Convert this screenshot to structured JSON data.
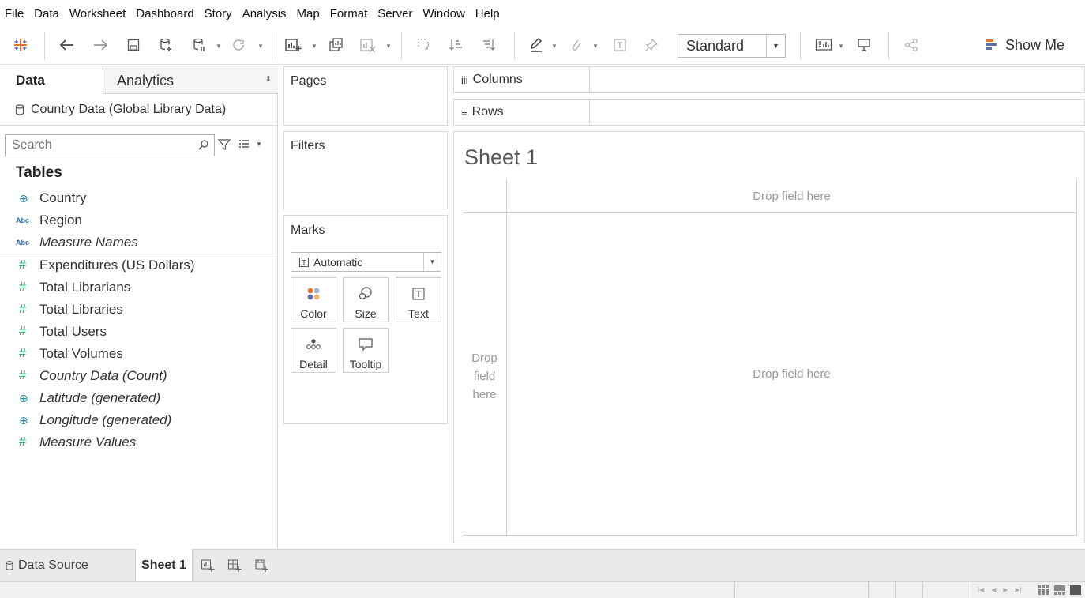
{
  "menu": [
    "File",
    "Data",
    "Worksheet",
    "Dashboard",
    "Story",
    "Analysis",
    "Map",
    "Format",
    "Server",
    "Window",
    "Help"
  ],
  "toolbar": {
    "fit_value": "Standard",
    "show_me_label": "Show Me"
  },
  "data_pane": {
    "tab_data": "Data",
    "tab_analytics": "Analytics",
    "datasource": "Country Data (Global Library Data)",
    "search_placeholder": "Search",
    "tables_title": "Tables",
    "dimensions": [
      {
        "label": "Country",
        "type": "geo",
        "italic": false
      },
      {
        "label": "Region",
        "type": "abc",
        "italic": false
      },
      {
        "label": "Measure Names",
        "type": "abc",
        "italic": true
      }
    ],
    "measures": [
      {
        "label": "Expenditures  (US Dollars)",
        "type": "number",
        "italic": false
      },
      {
        "label": "Total Librarians",
        "type": "number",
        "italic": false
      },
      {
        "label": "Total Libraries",
        "type": "number",
        "italic": false
      },
      {
        "label": "Total Users",
        "type": "number",
        "italic": false
      },
      {
        "label": "Total Volumes",
        "type": "number",
        "italic": false
      },
      {
        "label": "Country Data (Count)",
        "type": "number",
        "italic": true
      },
      {
        "label": "Latitude (generated)",
        "type": "geo",
        "italic": true
      },
      {
        "label": "Longitude (generated)",
        "type": "geo",
        "italic": true
      },
      {
        "label": "Measure Values",
        "type": "number",
        "italic": true
      }
    ],
    "abc_glyph": "Abc"
  },
  "cards": {
    "pages": "Pages",
    "filters": "Filters",
    "marks": "Marks",
    "mark_type": "Automatic",
    "mark_buttons": {
      "color": "Color",
      "size": "Size",
      "text": "Text",
      "detail": "Detail",
      "tooltip": "Tooltip"
    }
  },
  "shelves": {
    "columns": "Columns",
    "rows": "Rows"
  },
  "view": {
    "sheet_title": "Sheet 1",
    "drop_columns": "Drop field here",
    "drop_rows": "Drop field here",
    "drop_main": "Drop field here"
  },
  "bottom_tabs": {
    "datasource": "Data Source",
    "sheet1": "Sheet 1"
  },
  "colors": {
    "accent_blue": "#2a6bb3",
    "measure_green": "#27a36a",
    "geo_teal": "#1f8aa0",
    "show_me_orange": "#e8762b"
  }
}
